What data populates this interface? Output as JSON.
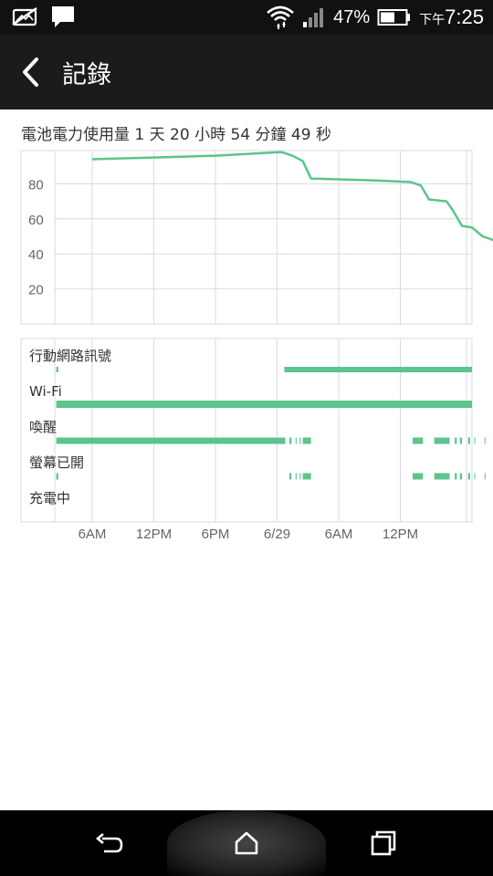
{
  "status_bar": {
    "battery_percent": "47%",
    "ampm": "下午",
    "time": "7:25",
    "icons": [
      "image-notification-icon",
      "message-notification-icon",
      "wifi-icon",
      "cell-signal-icon",
      "battery-icon"
    ]
  },
  "app_bar": {
    "title": "記錄"
  },
  "usage": {
    "heading": "電池電力使用量 1 天 20 小時 54 分鐘 49 秒"
  },
  "chart_data": {
    "type": "line",
    "ylim": [
      0,
      100
    ],
    "y_ticks": [
      "80",
      "60",
      "40",
      "20"
    ],
    "x_tick_labels": [
      "6AM",
      "12PM",
      "6PM",
      "6/29",
      "6AM",
      "12PM"
    ],
    "series": [
      {
        "points": [
          [
            0,
            94
          ],
          [
            6,
            95
          ],
          [
            12,
            96
          ],
          [
            18,
            98
          ],
          [
            18.5,
            98
          ],
          [
            19.5,
            96
          ],
          [
            20.5,
            93
          ],
          [
            21.3,
            83
          ],
          [
            27,
            82
          ],
          [
            31,
            81
          ],
          [
            32,
            79
          ],
          [
            32.8,
            71
          ],
          [
            34.5,
            70
          ],
          [
            35.2,
            64
          ],
          [
            36,
            56
          ],
          [
            37,
            55
          ],
          [
            38,
            50
          ],
          [
            39,
            48
          ],
          [
            40,
            47
          ]
        ]
      }
    ],
    "lanes": [
      {
        "label": "行動網路訊號",
        "segments": [
          [
            -3.5,
            -3.3
          ],
          [
            18.7,
            40.3
          ]
        ]
      },
      {
        "label": "Wi-Fi",
        "segments": [
          [
            -3.5,
            40.3
          ]
        ]
      },
      {
        "label": "喚醒",
        "segments": [
          [
            -3.5,
            18.8
          ],
          [
            19.2,
            19.4
          ],
          [
            19.8,
            19.9
          ],
          [
            20.2,
            20.3
          ],
          [
            20.5,
            21.3
          ],
          [
            31.2,
            32.2
          ],
          [
            33.3,
            34.8
          ],
          [
            35.3,
            35.5
          ],
          [
            35.8,
            36.0
          ],
          [
            36.6,
            36.8
          ],
          [
            37.2,
            37.4
          ],
          [
            38.2,
            38.3
          ]
        ]
      },
      {
        "label": "螢幕已開",
        "segments": [
          [
            -3.5,
            -3.3
          ],
          [
            19.2,
            19.4
          ],
          [
            19.8,
            19.9
          ],
          [
            20.2,
            20.3
          ],
          [
            20.5,
            21.3
          ],
          [
            31.2,
            32.2
          ],
          [
            33.3,
            34.8
          ],
          [
            35.3,
            35.5
          ],
          [
            35.8,
            36.0
          ],
          [
            36.6,
            36.8
          ],
          [
            37.2,
            37.4
          ],
          [
            38.2,
            38.3
          ]
        ]
      },
      {
        "label": "充電中",
        "segments": []
      }
    ],
    "colors": {
      "line": "#5cc48c",
      "grid": "#d9d9e6",
      "lane": "#5cc48c"
    }
  }
}
